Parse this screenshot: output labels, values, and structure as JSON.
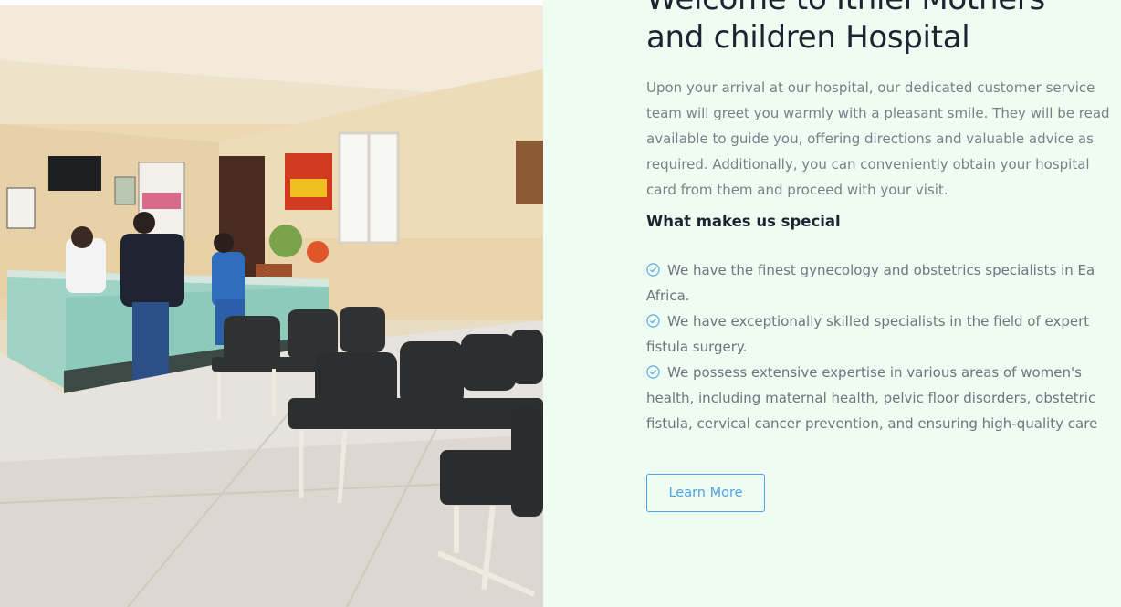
{
  "hero_image": {
    "alt": "Hospital reception area with waiting chairs"
  },
  "about": {
    "title_lines": [
      "Welcome to Ithiel Mothers",
      "and children Hospital"
    ],
    "intro_lines": [
      "Upon your arrival at our hospital, our dedicated customer service",
      "team will greet you warmly with a pleasant smile. They will be read",
      "available to guide you, offering directions and valuable advice as",
      "required. Additionally, you can conveniently obtain your hospital",
      "card from them and proceed with your visit."
    ],
    "special_heading": "What makes us special",
    "special_items": [
      {
        "icon": "check-circle-icon",
        "lines": [
          "We have the finest gynecology and obstetrics specialists in Ea",
          "Africa."
        ]
      },
      {
        "icon": "check-circle-icon",
        "lines": [
          "We have exceptionally skilled specialists in the field of expert",
          "fistula surgery."
        ]
      },
      {
        "icon": "check-circle-icon",
        "lines": [
          "We possess extensive expertise in various areas of women's",
          "health, including maternal health, pelvic floor disorders, obstetric",
          "fistula, cervical cancer prevention, and ensuring high-quality care"
        ]
      }
    ],
    "cta_label": "Learn More"
  },
  "colors": {
    "accent": "#4fa3e6",
    "panel_bg": "#eefcf2",
    "heading": "#1b2430",
    "text": "#7a8089"
  }
}
